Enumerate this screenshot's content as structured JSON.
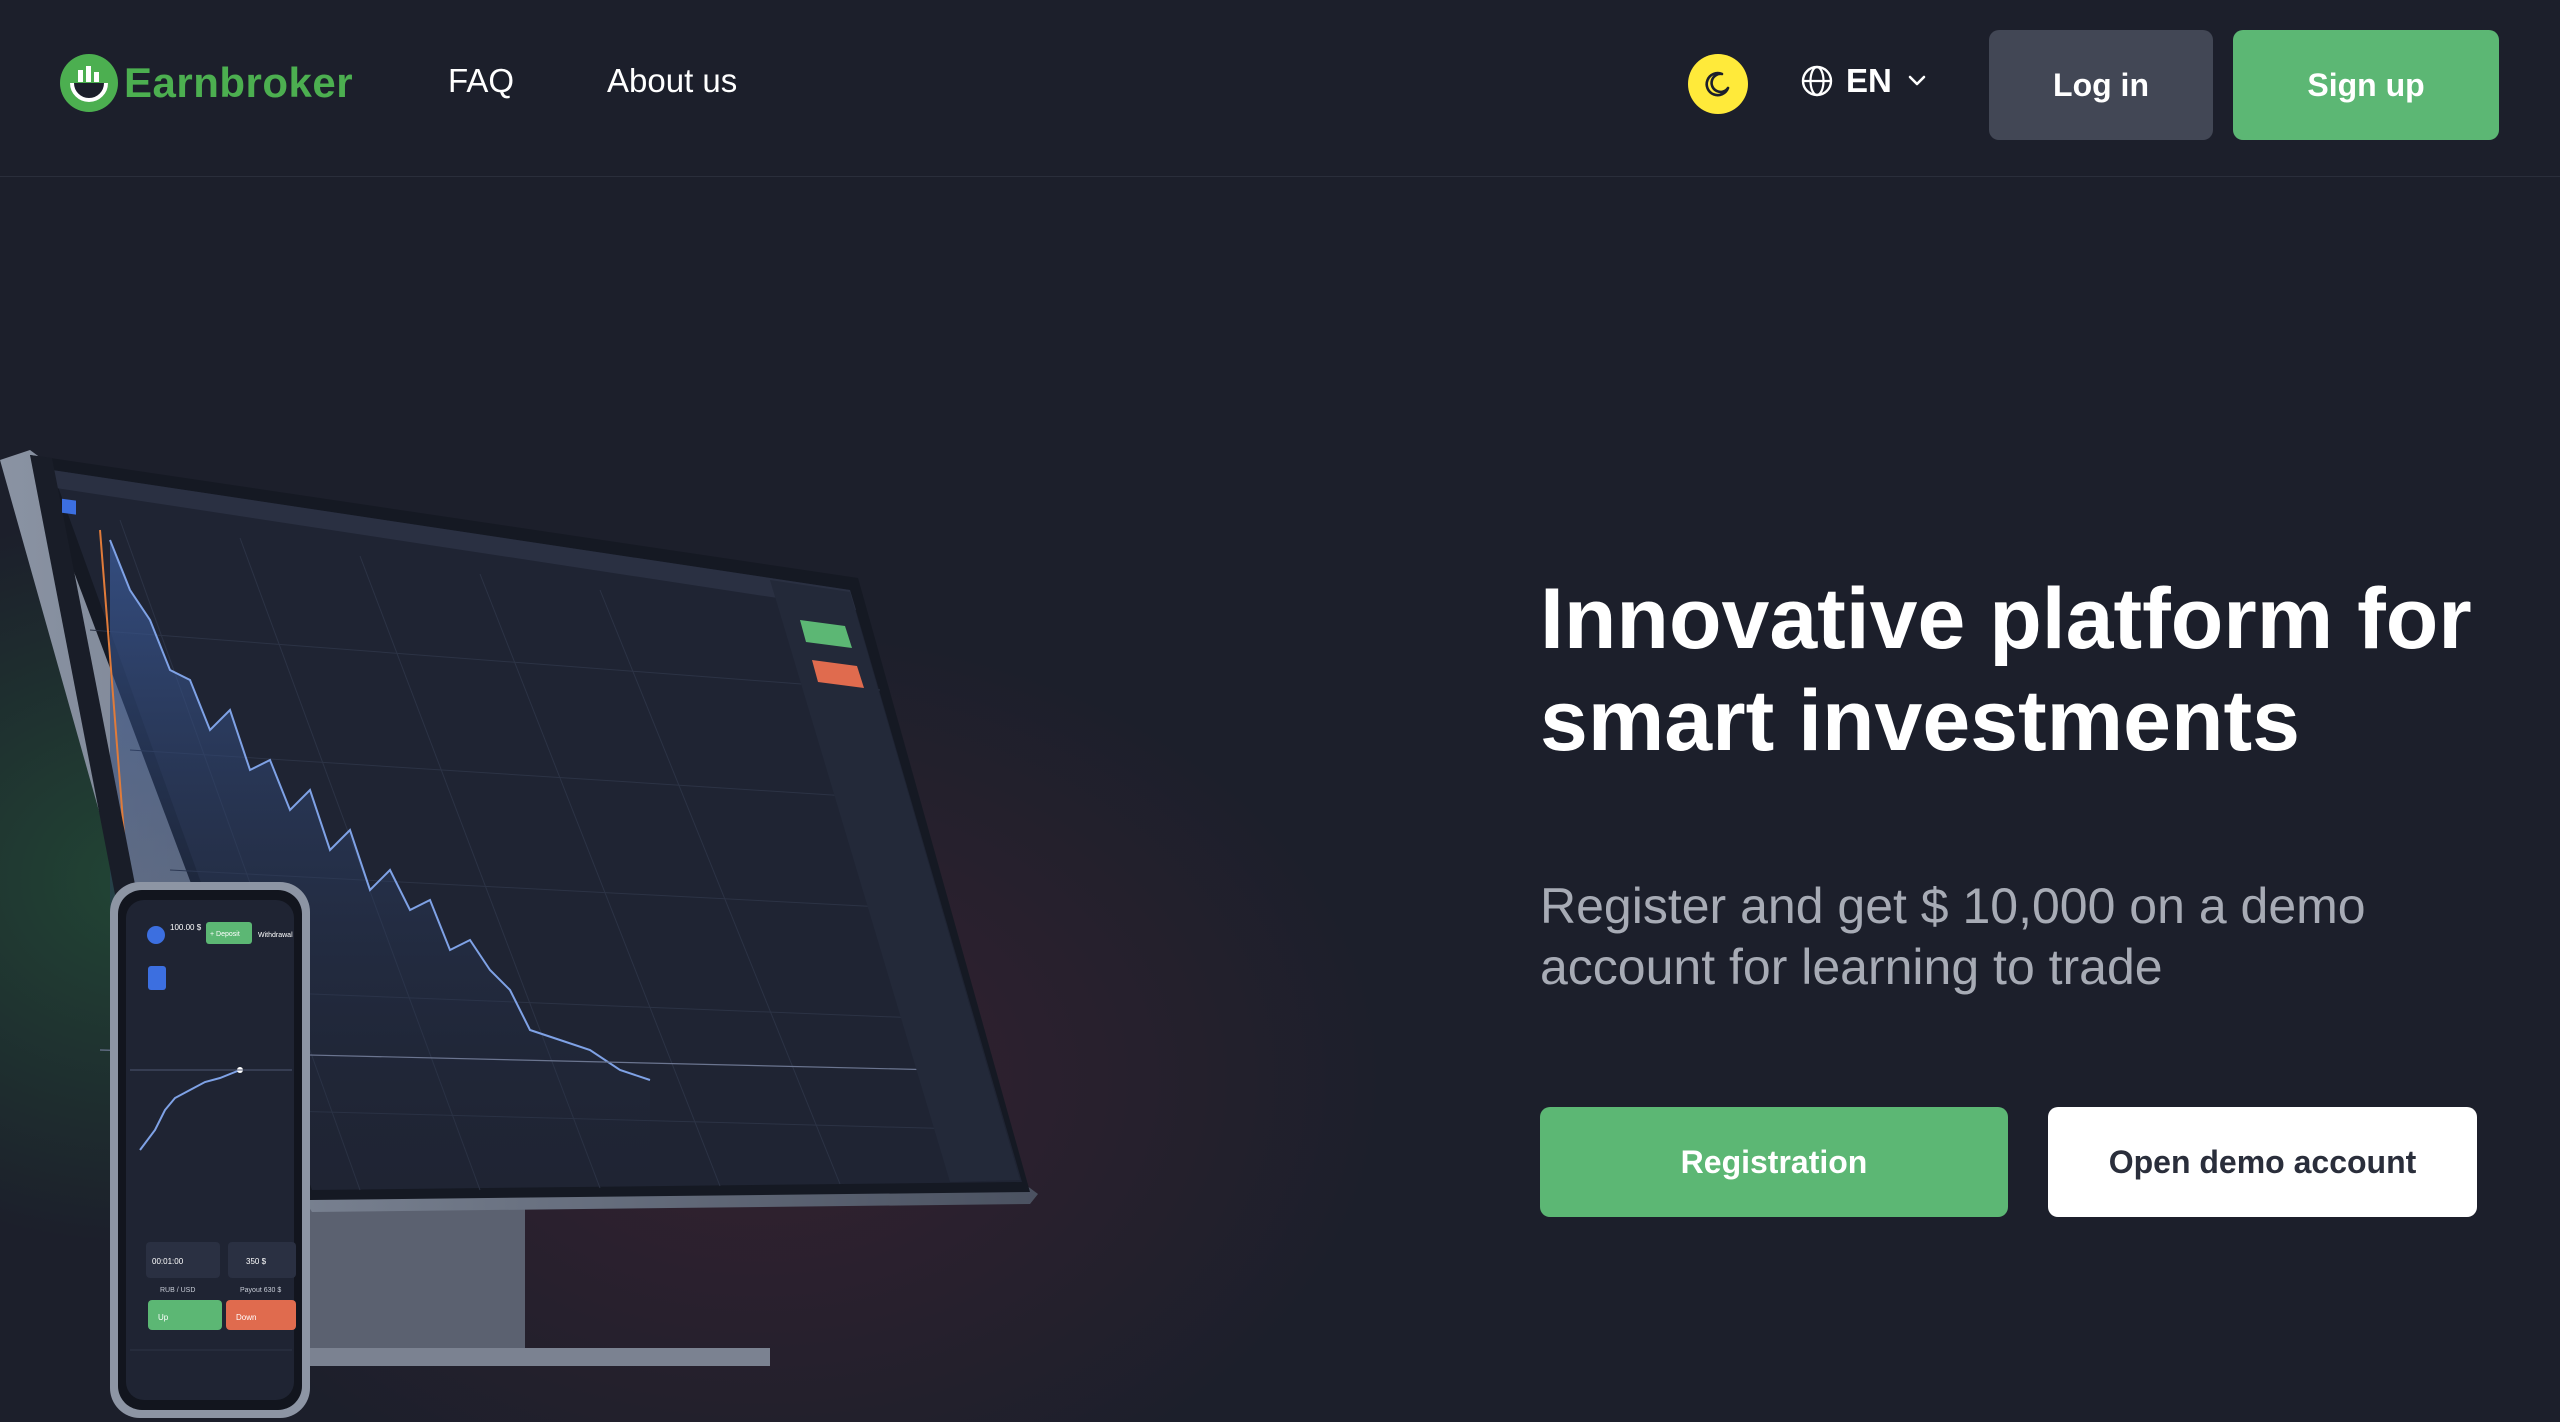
{
  "brand": {
    "name": "Earnbroker",
    "accent_color": "#5cb774",
    "logo_color": "#4caf50"
  },
  "nav": {
    "links": [
      {
        "label": "FAQ"
      },
      {
        "label": "About us"
      }
    ]
  },
  "header": {
    "theme_toggle_icon": "moon-icon",
    "language": {
      "icon": "globe-icon",
      "code": "EN",
      "dropdown_icon": "chevron-down-icon"
    },
    "login_label": "Log in",
    "signup_label": "Sign up"
  },
  "hero": {
    "title": "Innovative platform for smart investments",
    "subtitle": "Register and get $ 10,000 on a demo account for learning to trade",
    "register_label": "Registration",
    "demo_label": "Open demo account"
  },
  "illustration": {
    "description_icon": "trading-platform-monitor-and-phone",
    "phone": {
      "balance": "100.00 $",
      "deposit_label": "+ Deposit",
      "withdrawal_label": "Withdrawal",
      "time_value": "00:01:00",
      "amount_value": "350 $",
      "asset": "RUB / USD",
      "payout": "Payout 630 $",
      "up_label": "Up",
      "down_label": "Down"
    }
  }
}
